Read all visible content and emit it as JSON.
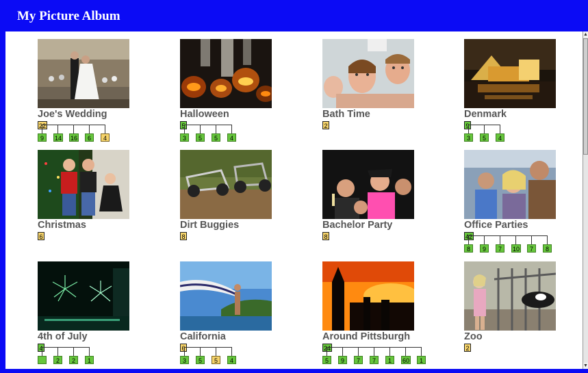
{
  "window": {
    "title": "My Picture Album"
  },
  "albums": [
    {
      "title": "Joe's Wedding",
      "photo": "wedding-dance",
      "root": {
        "count": "22",
        "color": "yellow"
      },
      "children": [
        {
          "count": "9",
          "color": "green"
        },
        {
          "count": "14",
          "color": "green"
        },
        {
          "count": "16",
          "color": "green"
        },
        {
          "count": "6",
          "color": "green"
        },
        {
          "count": "4",
          "color": "yellow"
        }
      ]
    },
    {
      "title": "Halloween",
      "photo": "jack-o-lanterns",
      "root": {
        "count": "5",
        "color": "green"
      },
      "children": [
        {
          "count": "3",
          "color": "green"
        },
        {
          "count": "5",
          "color": "green"
        },
        {
          "count": "5",
          "color": "green"
        },
        {
          "count": "4",
          "color": "green"
        }
      ]
    },
    {
      "title": "Bath Time",
      "photo": "kids-in-bath",
      "root": {
        "count": "2",
        "color": "yellow"
      },
      "children": []
    },
    {
      "title": "Denmark",
      "photo": "lit-building-night",
      "root": {
        "count": "9",
        "color": "green"
      },
      "children": [
        {
          "count": "3",
          "color": "green"
        },
        {
          "count": "5",
          "color": "green"
        },
        {
          "count": "4",
          "color": "green"
        }
      ]
    },
    {
      "title": "Christmas",
      "photo": "kids-by-tree",
      "root": {
        "count": "6",
        "color": "yellow"
      },
      "children": []
    },
    {
      "title": "Dirt Buggies",
      "photo": "dune-buggies",
      "root": {
        "count": "8",
        "color": "yellow"
      },
      "children": []
    },
    {
      "title": "Bachelor Party",
      "photo": "party-group",
      "root": {
        "count": "8",
        "color": "yellow"
      },
      "children": []
    },
    {
      "title": "Office Parties",
      "photo": "office-group",
      "root": {
        "count": "42",
        "color": "green"
      },
      "children": [
        {
          "count": "8",
          "color": "green"
        },
        {
          "count": "9",
          "color": "green"
        },
        {
          "count": "7",
          "color": "green"
        },
        {
          "count": "10",
          "color": "green"
        },
        {
          "count": "7",
          "color": "green"
        },
        {
          "count": "8",
          "color": "green"
        }
      ]
    },
    {
      "title": "4th of July",
      "photo": "fireworks",
      "root": {
        "count": "4",
        "color": "green"
      },
      "children": [
        {
          "count": "",
          "color": "green"
        },
        {
          "count": "2",
          "color": "green"
        },
        {
          "count": "2",
          "color": "green"
        },
        {
          "count": "1",
          "color": "green"
        }
      ]
    },
    {
      "title": "California",
      "photo": "beach-flag",
      "root": {
        "count": "6",
        "color": "yellow"
      },
      "children": [
        {
          "count": "3",
          "color": "green"
        },
        {
          "count": "5",
          "color": "green"
        },
        {
          "count": "5",
          "color": "yellow"
        },
        {
          "count": "4",
          "color": "green"
        }
      ]
    },
    {
      "title": "Around Pittsburgh",
      "photo": "city-sunset",
      "root": {
        "count": "24",
        "color": "green"
      },
      "children": [
        {
          "count": "5",
          "color": "green"
        },
        {
          "count": "9",
          "color": "green"
        },
        {
          "count": "7",
          "color": "green"
        },
        {
          "count": "7",
          "color": "green"
        },
        {
          "count": "1",
          "color": "green"
        },
        {
          "count": "60",
          "color": "green"
        },
        {
          "count": "1",
          "color": "green"
        }
      ]
    },
    {
      "title": "Zoo",
      "photo": "child-at-fence",
      "root": {
        "count": "2",
        "color": "yellow"
      },
      "children": []
    }
  ],
  "scrollbar": {
    "up_icon": "scroll-up-arrow",
    "down_icon": "scroll-down-arrow"
  }
}
